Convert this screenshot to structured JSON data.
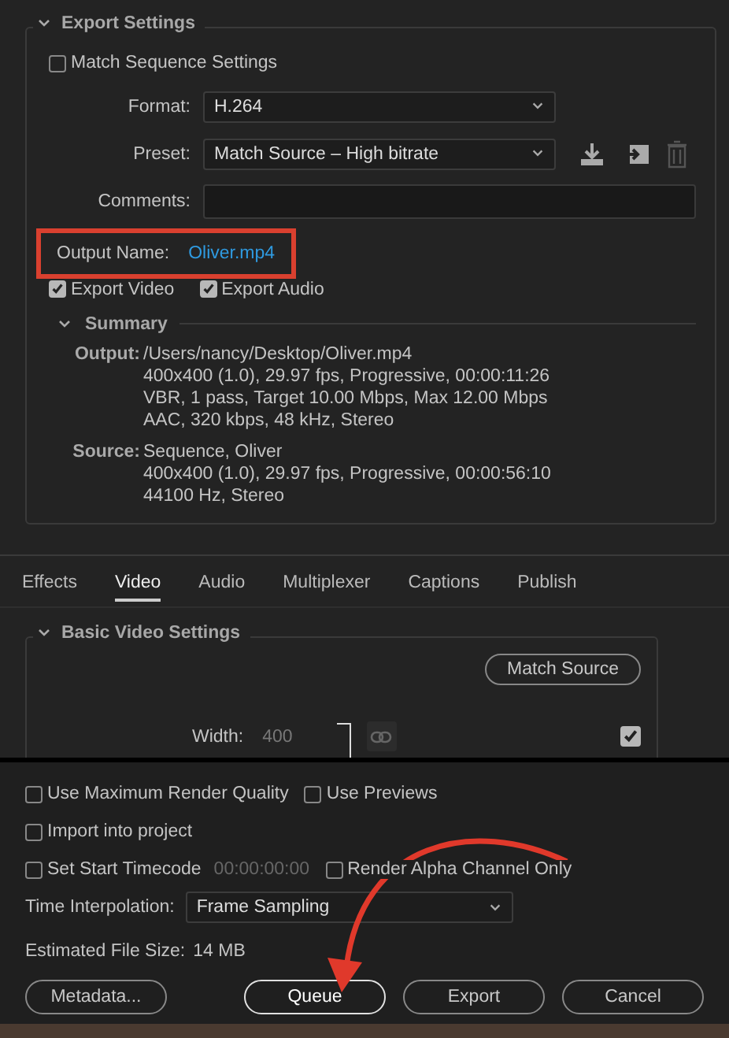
{
  "export_settings": {
    "title": "Export Settings",
    "expanded": true,
    "match_sequence": {
      "label": "Match Sequence Settings",
      "checked": false
    },
    "fields": [
      {
        "label": "Format:",
        "value": "H.264",
        "kind": "dropdown"
      },
      {
        "label": "Preset:",
        "value": "Match Source – High bitrate",
        "kind": "dropdown"
      },
      {
        "label": "Comments:",
        "kind": "text"
      }
    ],
    "output_name": {
      "label": "Output Name:",
      "value": "Oliver.mp4",
      "highlighted": true
    },
    "export_checks": [
      {
        "label": "Export Video",
        "checked": true
      },
      {
        "label": "Export Audio",
        "checked": true
      }
    ],
    "summary": {
      "title": "Summary",
      "expanded": true,
      "entries": [
        {
          "label": "Output:",
          "lines": [
            "/Users/nancy/Desktop/Oliver.mp4",
            "400x400 (1.0), 29.97 fps, Progressive, 00:00:11:26",
            "VBR, 1 pass, Target 10.00 Mbps, Max 12.00 Mbps",
            "AAC, 320 kbps, 48 kHz, Stereo"
          ]
        },
        {
          "label": "Source:",
          "lines": [
            "Sequence, Oliver",
            "400x400 (1.0), 29.97 fps, Progressive, 00:00:56:10",
            "44100 Hz, Stereo"
          ]
        }
      ]
    }
  },
  "tabs": [
    {
      "label": "Effects",
      "selected": false
    },
    {
      "label": "Video",
      "selected": true
    },
    {
      "label": "Audio",
      "selected": false
    },
    {
      "label": "Multiplexer",
      "selected": false
    },
    {
      "label": "Captions",
      "selected": false
    },
    {
      "label": "Publish",
      "selected": false
    }
  ],
  "video": {
    "title": "Basic Video Settings",
    "expanded": true,
    "match_button": "Match Source",
    "width": {
      "label": "Width:",
      "value": "400"
    },
    "side_check": {
      "checked": true
    }
  },
  "option_rows": [
    {
      "items": [
        {
          "label": "Use Maximum Render Quality",
          "checked": false
        },
        {
          "label": "Use Previews",
          "checked": false
        }
      ]
    },
    {
      "items": [
        {
          "label": "Import into project",
          "checked": false
        }
      ]
    },
    {
      "items": [
        {
          "label": "Set Start Timecode",
          "checked": false,
          "timecode": "00:00:00:00"
        },
        {
          "label": "Render Alpha Channel Only",
          "checked": false
        }
      ]
    }
  ],
  "time_interpolation": {
    "label": "Time Interpolation:",
    "value": "Frame Sampling"
  },
  "file_size": {
    "label": "Estimated File Size:",
    "value": "14 MB"
  },
  "buttons": [
    {
      "label": "Metadata...",
      "default": false
    },
    {
      "label": "Queue",
      "default": true
    },
    {
      "label": "Export",
      "default": false
    },
    {
      "label": "Cancel",
      "default": false
    }
  ]
}
